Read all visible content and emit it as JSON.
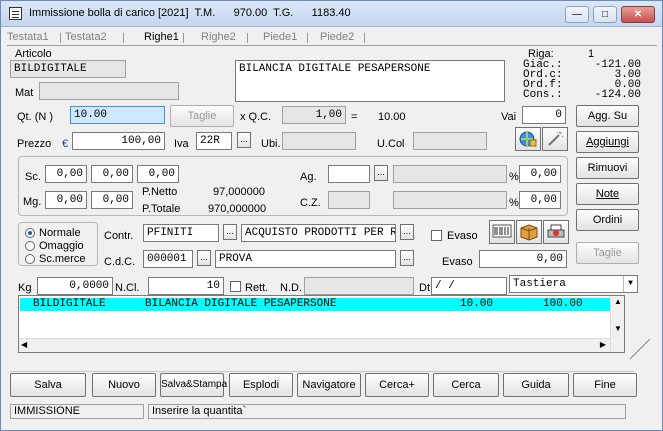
{
  "window": {
    "title": "Immissione bolla di carico [2021]  T.M.      970.00  T.G.      1183.40"
  },
  "tabs": [
    "Testata1",
    "Testata2",
    "Righe1",
    "Righe2",
    "Piede1",
    "Piede2"
  ],
  "articolo": {
    "label": "Articolo",
    "code": "BILDIGITALE",
    "description": "BILANCIA DIGITALE PESAPERSONE"
  },
  "riga": {
    "label": "Riga:",
    "value": "1"
  },
  "giacenze": {
    "giac_label": "Giac.:",
    "giac": "-121.00",
    "ordc_label": "Ord.c:",
    "ordc": "3.00",
    "ordf_label": "Ord.f:",
    "ordf": "0.00",
    "cons_label": "Cons.:",
    "cons": "-124.00"
  },
  "mat": {
    "label": "Mat"
  },
  "qt": {
    "label": "Qt.  (N )",
    "value": "10.00",
    "taglie": "Taglie",
    "xqc": "x  Q.C.",
    "qc": "1,00",
    "eq": "=",
    "result": "10.00"
  },
  "vai": {
    "label": "Vai",
    "value": "0"
  },
  "prezzo": {
    "label": "Prezzo",
    "currency": "€",
    "value": "100,00",
    "iva_label": "Iva",
    "iva": "22R",
    "ubi_label": "Ubi.",
    "ucol_label": "U.Col"
  },
  "sconti": {
    "label": "Sc.",
    "values": [
      "0,00",
      "0,00",
      "0,00"
    ]
  },
  "margini": {
    "label": "Mg.",
    "values": [
      "0,00",
      "0,00"
    ]
  },
  "netto": {
    "pnetto_label": "P.Netto",
    "pnetto": "97,000000",
    "ptotale_label": "P.Totale",
    "ptotale": "970,000000"
  },
  "agente": {
    "label": "Ag.",
    "pct": "0,00",
    "pct_sign": "%"
  },
  "cz": {
    "label": "C.Z.",
    "pct": "0,00",
    "pct_sign": "%"
  },
  "tipo": {
    "options": [
      "Normale",
      "Omaggio",
      "Sc.merce"
    ],
    "selected": "Normale"
  },
  "contr": {
    "label": "Contr.",
    "code": "PFINITI",
    "description": "ACQUISTO PRODOTTI PER R"
  },
  "evaso": {
    "label": "Evaso",
    "label2": "Evaso",
    "value": "0,00"
  },
  "cdc": {
    "label": "C.d.C.",
    "code": "000001",
    "description": "PROVA"
  },
  "kg": {
    "label": "Kg",
    "value": "0,0000",
    "ncl_label": "N.Cl.",
    "ncl": "10",
    "rett_label": "Rett.",
    "nd_label": "N.D.",
    "dt_label": "Dt",
    "dt": "/    /"
  },
  "tastiera": {
    "value": "Tastiera"
  },
  "side_buttons": {
    "agg_su": "Agg. Su",
    "aggiungi": "Aggiungi",
    "rimuovi": "Rimuovi",
    "note": "Note",
    "ordini": "Ordini",
    "taglie": "Taglie"
  },
  "grid": {
    "rows": [
      {
        "code": "BILDIGITALE",
        "description": "BILANCIA DIGITALE PESAPERSONE",
        "qty": "10.00",
        "price": "100.00"
      }
    ]
  },
  "bottom_buttons": [
    "Salva",
    "Nuovo",
    "Salva&Stampa",
    "Esplodi",
    "Navigatore",
    "Cerca+",
    "Cerca",
    "Guida",
    "Fine"
  ],
  "status": {
    "mode": "IMMISSIONE",
    "message": "Inserire la quantita`"
  }
}
